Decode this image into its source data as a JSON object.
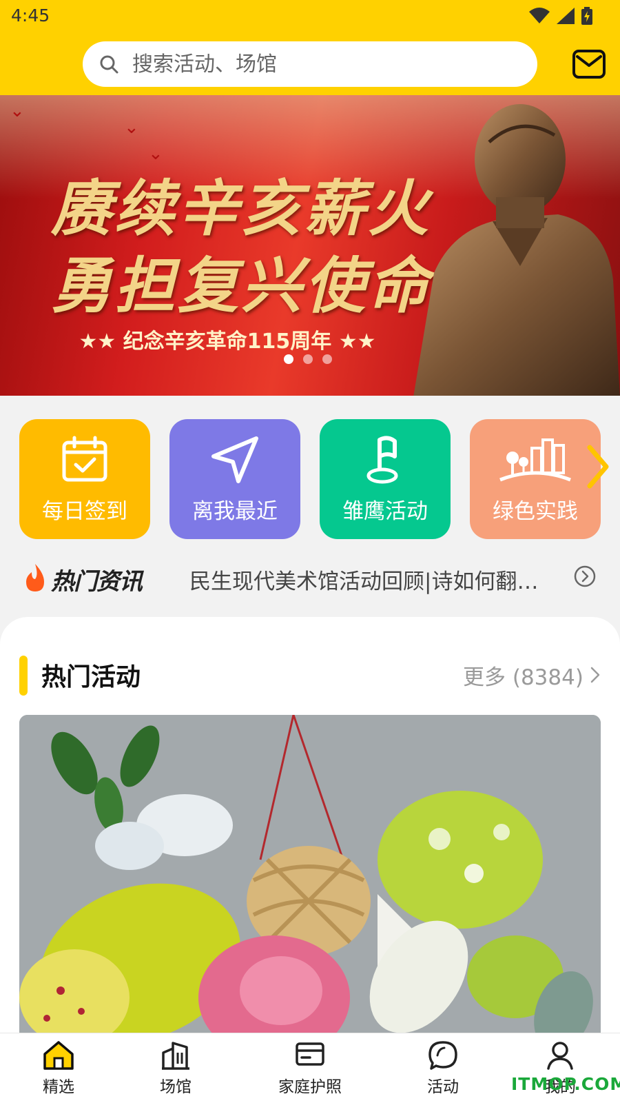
{
  "status_bar": {
    "time": "4:45"
  },
  "search": {
    "placeholder": "搜索活动、场馆"
  },
  "banner": {
    "title_line1": "赓续辛亥薪火",
    "title_line2": "勇担复兴使命",
    "subtitle": "★★ 纪念辛亥革命115周年 ★★",
    "dot_count": 3,
    "active_dot": 1
  },
  "quick_entries": [
    {
      "label": "每日签到",
      "icon": "calendar-check-icon",
      "color": "#ffbb00"
    },
    {
      "label": "离我最近",
      "icon": "navigation-arrow-icon",
      "color": "#7e79e6"
    },
    {
      "label": "雏鹰活动",
      "icon": "flag-pin-icon",
      "color": "#05c88f"
    },
    {
      "label": "绿色实践",
      "icon": "city-tree-icon",
      "color": "#f7a07a"
    }
  ],
  "news": {
    "brand": "热门资讯",
    "headline": "民生现代美术馆活动回顾|诗如何翻…"
  },
  "hot_activities": {
    "title": "热门活动",
    "more_label": "更多 (8384)"
  },
  "tabbar": [
    {
      "label": "精选",
      "icon": "home-icon",
      "active": true
    },
    {
      "label": "场馆",
      "icon": "building-icon",
      "active": false
    },
    {
      "label": "家庭护照",
      "icon": "passport-card-icon",
      "active": false
    },
    {
      "label": "活动",
      "icon": "chat-bubble-icon",
      "active": false
    },
    {
      "label": "我的",
      "icon": "person-icon",
      "active": false
    }
  ],
  "watermark": "ITMOP.COM",
  "colors": {
    "accent_yellow": "#ffd100",
    "banner_red": "#d21d1d",
    "gold_text": "#f3d488"
  }
}
